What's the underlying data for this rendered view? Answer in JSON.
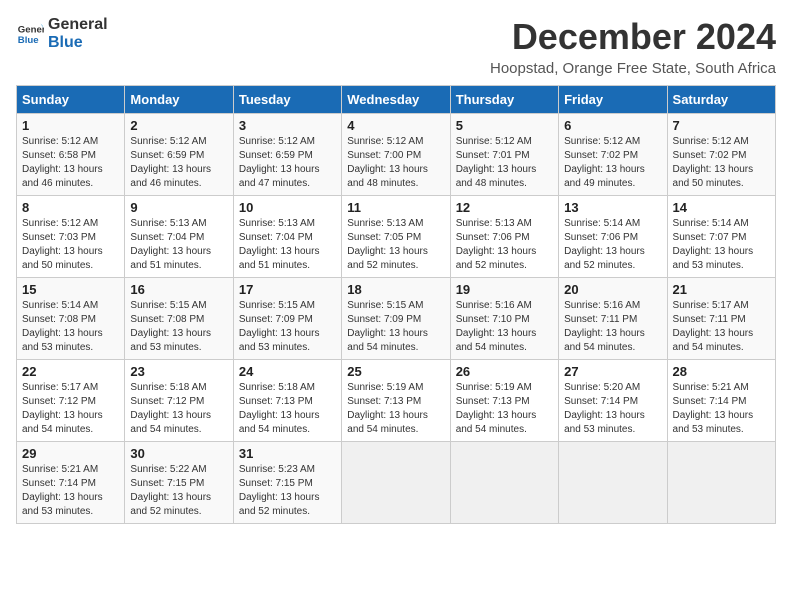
{
  "logo": {
    "line1": "General",
    "line2": "Blue"
  },
  "title": "December 2024",
  "subtitle": "Hoopstad, Orange Free State, South Africa",
  "days_header": [
    "Sunday",
    "Monday",
    "Tuesday",
    "Wednesday",
    "Thursday",
    "Friday",
    "Saturday"
  ],
  "weeks": [
    [
      {
        "day": "1",
        "sunrise": "Sunrise: 5:12 AM",
        "sunset": "Sunset: 6:58 PM",
        "daylight": "Daylight: 13 hours and 46 minutes."
      },
      {
        "day": "2",
        "sunrise": "Sunrise: 5:12 AM",
        "sunset": "Sunset: 6:59 PM",
        "daylight": "Daylight: 13 hours and 46 minutes."
      },
      {
        "day": "3",
        "sunrise": "Sunrise: 5:12 AM",
        "sunset": "Sunset: 6:59 PM",
        "daylight": "Daylight: 13 hours and 47 minutes."
      },
      {
        "day": "4",
        "sunrise": "Sunrise: 5:12 AM",
        "sunset": "Sunset: 7:00 PM",
        "daylight": "Daylight: 13 hours and 48 minutes."
      },
      {
        "day": "5",
        "sunrise": "Sunrise: 5:12 AM",
        "sunset": "Sunset: 7:01 PM",
        "daylight": "Daylight: 13 hours and 48 minutes."
      },
      {
        "day": "6",
        "sunrise": "Sunrise: 5:12 AM",
        "sunset": "Sunset: 7:02 PM",
        "daylight": "Daylight: 13 hours and 49 minutes."
      },
      {
        "day": "7",
        "sunrise": "Sunrise: 5:12 AM",
        "sunset": "Sunset: 7:02 PM",
        "daylight": "Daylight: 13 hours and 50 minutes."
      }
    ],
    [
      {
        "day": "8",
        "sunrise": "Sunrise: 5:12 AM",
        "sunset": "Sunset: 7:03 PM",
        "daylight": "Daylight: 13 hours and 50 minutes."
      },
      {
        "day": "9",
        "sunrise": "Sunrise: 5:13 AM",
        "sunset": "Sunset: 7:04 PM",
        "daylight": "Daylight: 13 hours and 51 minutes."
      },
      {
        "day": "10",
        "sunrise": "Sunrise: 5:13 AM",
        "sunset": "Sunset: 7:04 PM",
        "daylight": "Daylight: 13 hours and 51 minutes."
      },
      {
        "day": "11",
        "sunrise": "Sunrise: 5:13 AM",
        "sunset": "Sunset: 7:05 PM",
        "daylight": "Daylight: 13 hours and 52 minutes."
      },
      {
        "day": "12",
        "sunrise": "Sunrise: 5:13 AM",
        "sunset": "Sunset: 7:06 PM",
        "daylight": "Daylight: 13 hours and 52 minutes."
      },
      {
        "day": "13",
        "sunrise": "Sunrise: 5:14 AM",
        "sunset": "Sunset: 7:06 PM",
        "daylight": "Daylight: 13 hours and 52 minutes."
      },
      {
        "day": "14",
        "sunrise": "Sunrise: 5:14 AM",
        "sunset": "Sunset: 7:07 PM",
        "daylight": "Daylight: 13 hours and 53 minutes."
      }
    ],
    [
      {
        "day": "15",
        "sunrise": "Sunrise: 5:14 AM",
        "sunset": "Sunset: 7:08 PM",
        "daylight": "Daylight: 13 hours and 53 minutes."
      },
      {
        "day": "16",
        "sunrise": "Sunrise: 5:15 AM",
        "sunset": "Sunset: 7:08 PM",
        "daylight": "Daylight: 13 hours and 53 minutes."
      },
      {
        "day": "17",
        "sunrise": "Sunrise: 5:15 AM",
        "sunset": "Sunset: 7:09 PM",
        "daylight": "Daylight: 13 hours and 53 minutes."
      },
      {
        "day": "18",
        "sunrise": "Sunrise: 5:15 AM",
        "sunset": "Sunset: 7:09 PM",
        "daylight": "Daylight: 13 hours and 54 minutes."
      },
      {
        "day": "19",
        "sunrise": "Sunrise: 5:16 AM",
        "sunset": "Sunset: 7:10 PM",
        "daylight": "Daylight: 13 hours and 54 minutes."
      },
      {
        "day": "20",
        "sunrise": "Sunrise: 5:16 AM",
        "sunset": "Sunset: 7:11 PM",
        "daylight": "Daylight: 13 hours and 54 minutes."
      },
      {
        "day": "21",
        "sunrise": "Sunrise: 5:17 AM",
        "sunset": "Sunset: 7:11 PM",
        "daylight": "Daylight: 13 hours and 54 minutes."
      }
    ],
    [
      {
        "day": "22",
        "sunrise": "Sunrise: 5:17 AM",
        "sunset": "Sunset: 7:12 PM",
        "daylight": "Daylight: 13 hours and 54 minutes."
      },
      {
        "day": "23",
        "sunrise": "Sunrise: 5:18 AM",
        "sunset": "Sunset: 7:12 PM",
        "daylight": "Daylight: 13 hours and 54 minutes."
      },
      {
        "day": "24",
        "sunrise": "Sunrise: 5:18 AM",
        "sunset": "Sunset: 7:13 PM",
        "daylight": "Daylight: 13 hours and 54 minutes."
      },
      {
        "day": "25",
        "sunrise": "Sunrise: 5:19 AM",
        "sunset": "Sunset: 7:13 PM",
        "daylight": "Daylight: 13 hours and 54 minutes."
      },
      {
        "day": "26",
        "sunrise": "Sunrise: 5:19 AM",
        "sunset": "Sunset: 7:13 PM",
        "daylight": "Daylight: 13 hours and 54 minutes."
      },
      {
        "day": "27",
        "sunrise": "Sunrise: 5:20 AM",
        "sunset": "Sunset: 7:14 PM",
        "daylight": "Daylight: 13 hours and 53 minutes."
      },
      {
        "day": "28",
        "sunrise": "Sunrise: 5:21 AM",
        "sunset": "Sunset: 7:14 PM",
        "daylight": "Daylight: 13 hours and 53 minutes."
      }
    ],
    [
      {
        "day": "29",
        "sunrise": "Sunrise: 5:21 AM",
        "sunset": "Sunset: 7:14 PM",
        "daylight": "Daylight: 13 hours and 53 minutes."
      },
      {
        "day": "30",
        "sunrise": "Sunrise: 5:22 AM",
        "sunset": "Sunset: 7:15 PM",
        "daylight": "Daylight: 13 hours and 52 minutes."
      },
      {
        "day": "31",
        "sunrise": "Sunrise: 5:23 AM",
        "sunset": "Sunset: 7:15 PM",
        "daylight": "Daylight: 13 hours and 52 minutes."
      },
      null,
      null,
      null,
      null
    ]
  ]
}
